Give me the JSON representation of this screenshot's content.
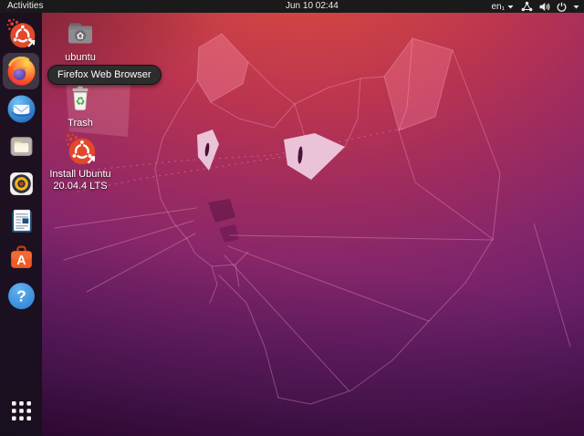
{
  "topbar": {
    "activities_label": "Activities",
    "clock": "Jun 10 02:44",
    "input_source": "en₁",
    "system_icons": [
      "network-icon",
      "volume-icon",
      "power-icon",
      "dropdown-caret-icon"
    ]
  },
  "tooltip": {
    "text": "Firefox Web Browser"
  },
  "dock": {
    "items": [
      {
        "id": "install-ubuntu",
        "icon": "ubuntu-installer-icon"
      },
      {
        "id": "firefox",
        "icon": "firefox-icon",
        "hovered": true
      },
      {
        "id": "thunderbird",
        "icon": "thunderbird-icon"
      },
      {
        "id": "files",
        "icon": "files-icon"
      },
      {
        "id": "rhythmbox",
        "icon": "rhythmbox-icon"
      },
      {
        "id": "libreoffice-writer",
        "icon": "libreoffice-writer-icon"
      },
      {
        "id": "ubuntu-software",
        "icon": "ubuntu-software-icon"
      },
      {
        "id": "help",
        "icon": "help-icon"
      },
      {
        "id": "show-applications",
        "icon": "show-applications-icon"
      }
    ],
    "software_letter": "A",
    "help_glyph": "?"
  },
  "desktop": {
    "icons": [
      {
        "label": "ubuntu",
        "icon": "home-folder-icon"
      },
      {
        "label": "Trash",
        "icon": "trash-icon"
      },
      {
        "label_line1": "Install Ubuntu",
        "label_line2": "20.04.4 LTS",
        "icon": "ubuntu-installer-icon"
      }
    ],
    "trash_glyph": "♻"
  },
  "colors": {
    "accent_orange": "#E95420",
    "topbar_bg": "#1b1a1b",
    "dock_bg": "#18101e",
    "tooltip_bg": "#2d2d2d",
    "wallpaper_top": "#cf4344",
    "wallpaper_mid": "#86266a",
    "wallpaper_bottom": "#3a0d3f"
  }
}
